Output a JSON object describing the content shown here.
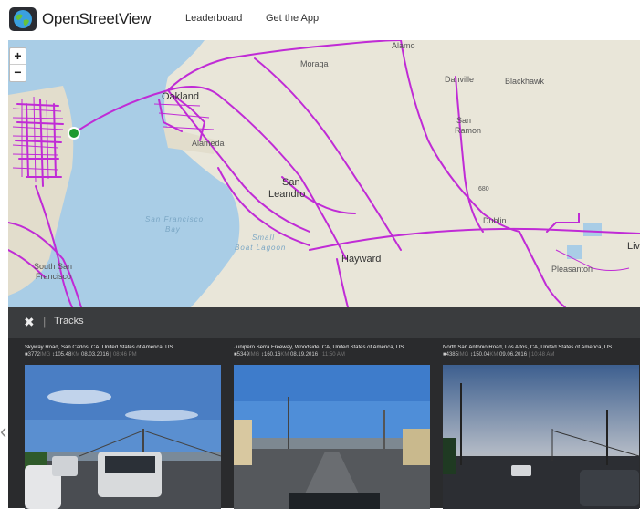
{
  "header": {
    "brand": "OpenStreetView",
    "nav": [
      {
        "label": "Leaderboard"
      },
      {
        "label": "Get the App"
      }
    ]
  },
  "map": {
    "zoom_in": "+",
    "zoom_out": "−",
    "labels": {
      "alamo": "Alamo",
      "moraga": "Moraga",
      "danville": "Danville",
      "blackhawk": "Blackhawk",
      "oakland": "Oakland",
      "alameda": "Alameda",
      "san_ramon_1": "San",
      "san_ramon_2": "Ramon",
      "san_leandro_1": "San",
      "san_leandro_2": "Leandro",
      "dublin": "Dublin",
      "sf_bay_1": "San Francisco",
      "sf_bay_2": "Bay",
      "small_boat_1": "Small",
      "small_boat_2": "Boat Lagoon",
      "hayward": "Hayward",
      "south_sf_1": "South San",
      "south_sf_2": "Francisco",
      "pleasanton": "Pleasanton",
      "livermore": "Liv",
      "route_680": "680"
    },
    "colors": {
      "track": "#c02bd6",
      "water": "#a9cde6",
      "land": "#e9e6d9",
      "marker": "#1e9a2e"
    }
  },
  "tracks": {
    "close": "✖",
    "separator": "|",
    "title": "Tracks",
    "prev": "‹",
    "cards": [
      {
        "title": "Skyway Road, San Carlos, CA, United States of America, US",
        "photos": "3772",
        "photos_unit": "IMG",
        "distance": "105.48",
        "distance_unit": "KM",
        "date": "08.03.2016",
        "time": "08:46 PM"
      },
      {
        "title": "Junipero Serra Freeway, Woodside, CA, United States of America, US",
        "photos": "5349",
        "photos_unit": "IMG",
        "distance": "160.16",
        "distance_unit": "KM",
        "date": "08.19.2016",
        "time": "11:50 AM"
      },
      {
        "title": "North San Antonio Road, Los Altos, CA, United States of America, US",
        "photos": "4385",
        "photos_unit": "IMG",
        "distance": "150.04",
        "distance_unit": "KM",
        "date": "09.06.2016",
        "time": "10:48 AM"
      }
    ]
  }
}
